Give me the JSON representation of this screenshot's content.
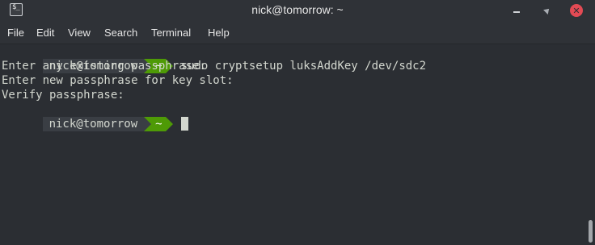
{
  "window": {
    "title": "nick@tomorrow: ~",
    "app_icon_text": "$_",
    "close_color": "#e34a54"
  },
  "menu": {
    "items": [
      "File",
      "Edit",
      "View",
      "Search",
      "Terminal",
      "Help"
    ]
  },
  "terminal": {
    "prompt_user": "nick@tomorrow",
    "prompt_dir": "~",
    "prompt_dir_color": "#4e9a06",
    "command": "sudo cryptsetup luksAddKey /dev/sdc2",
    "output": [
      "Enter any existing passphrase:",
      "Enter new passphrase for key slot:",
      "Verify passphrase:"
    ]
  }
}
